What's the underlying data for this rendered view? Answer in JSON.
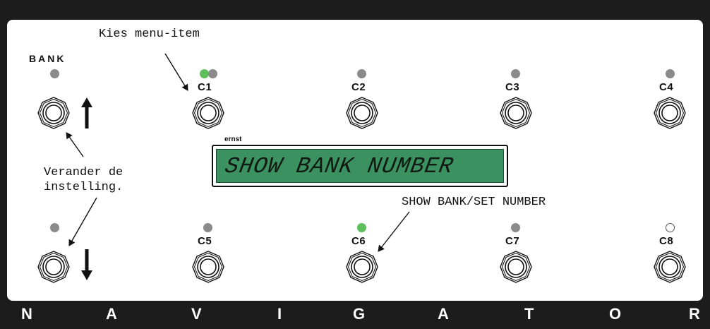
{
  "annotations": {
    "top": "Kies menu-item",
    "left_line1": "Verander de",
    "left_line2": "instelling.",
    "mid": "SHOW BANK/SET NUMBER"
  },
  "bank_label": "BANK",
  "display": {
    "owner": "ernst",
    "text": "SHOW BANK NUMBER",
    "color": "#3c9160"
  },
  "switches": [
    {
      "label": "C1",
      "led": "green+grey"
    },
    {
      "label": "C2",
      "led": "grey"
    },
    {
      "label": "C3",
      "led": "grey"
    },
    {
      "label": "C4",
      "led": "grey"
    },
    {
      "label": "C5",
      "led": "grey"
    },
    {
      "label": "C6",
      "led": "green"
    },
    {
      "label": "C7",
      "led": "grey"
    },
    {
      "label": "C8",
      "led": "off"
    }
  ],
  "colors": {
    "led_green": "#5cbf5c",
    "led_grey": "#8a8a8a",
    "background": "#1c1c1c"
  },
  "icons": [
    "arrow-up-icon",
    "arrow-down-icon"
  ],
  "brand_letters": [
    "N",
    "A",
    "V",
    "I",
    "G",
    "A",
    "T",
    "O",
    "R"
  ]
}
